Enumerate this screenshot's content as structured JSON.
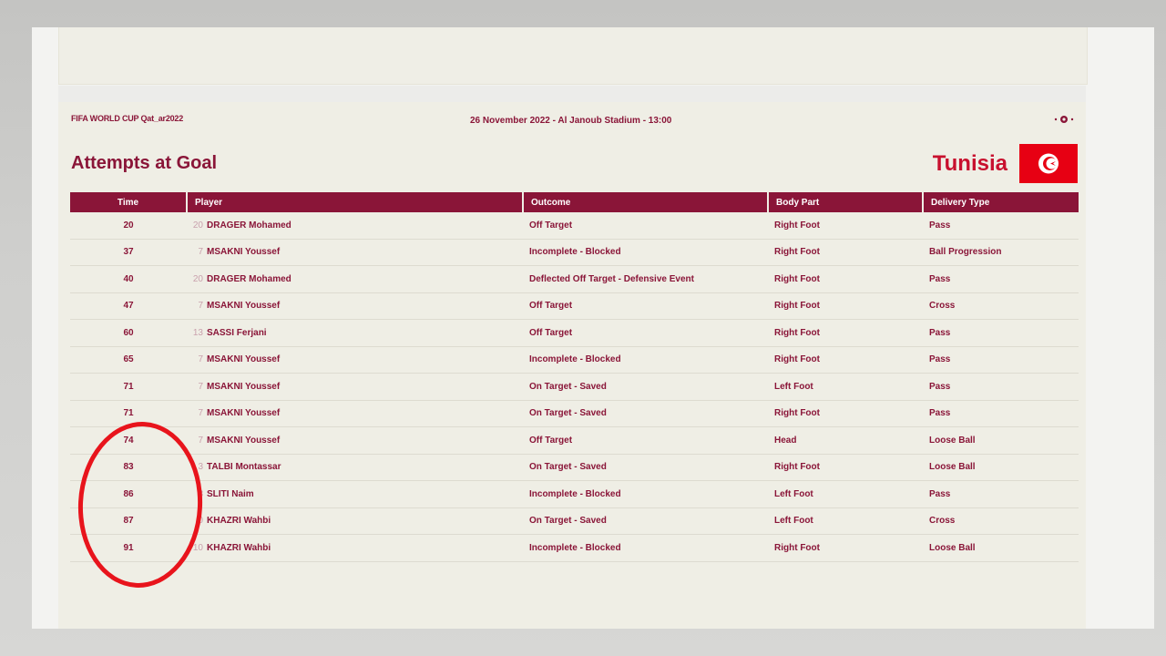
{
  "header": {
    "brand": "FIFA WORLD CUP Qat_ar2022",
    "match_info": "26 November 2022 - Al Janoub Stadium - 13:00"
  },
  "title": "Attempts at Goal",
  "team": {
    "name": "Tunisia",
    "flag_color": "#e70013"
  },
  "columns": [
    "Time",
    "Player",
    "Outcome",
    "Body Part",
    "Delivery Type"
  ],
  "rows": [
    {
      "time": "20",
      "num": "20",
      "player": "DRAGER Mohamed",
      "outcome": "Off Target",
      "body": "Right Foot",
      "delivery": "Pass"
    },
    {
      "time": "37",
      "num": "7",
      "player": "MSAKNI Youssef",
      "outcome": "Incomplete - Blocked",
      "body": "Right Foot",
      "delivery": "Ball Progression"
    },
    {
      "time": "40",
      "num": "20",
      "player": "DRAGER Mohamed",
      "outcome": "Deflected Off Target - Defensive Event",
      "body": "Right Foot",
      "delivery": "Pass"
    },
    {
      "time": "47",
      "num": "7",
      "player": "MSAKNI Youssef",
      "outcome": "Off Target",
      "body": "Right Foot",
      "delivery": "Cross"
    },
    {
      "time": "60",
      "num": "13",
      "player": "SASSI Ferjani",
      "outcome": "Off Target",
      "body": "Right Foot",
      "delivery": "Pass"
    },
    {
      "time": "65",
      "num": "7",
      "player": "MSAKNI Youssef",
      "outcome": "Incomplete - Blocked",
      "body": "Right Foot",
      "delivery": "Pass"
    },
    {
      "time": "71",
      "num": "7",
      "player": "MSAKNI Youssef",
      "outcome": "On Target - Saved",
      "body": "Left Foot",
      "delivery": "Pass"
    },
    {
      "time": "71",
      "num": "7",
      "player": "MSAKNI Youssef",
      "outcome": "On Target - Saved",
      "body": "Right Foot",
      "delivery": "Pass"
    },
    {
      "time": "74",
      "num": "7",
      "player": "MSAKNI Youssef",
      "outcome": "Off Target",
      "body": "Head",
      "delivery": "Loose Ball"
    },
    {
      "time": "83",
      "num": "3",
      "player": "TALBI Montassar",
      "outcome": "On Target - Saved",
      "body": "Right Foot",
      "delivery": "Loose Ball"
    },
    {
      "time": "86",
      "num": "3",
      "player": "SLITI Naim",
      "outcome": "Incomplete - Blocked",
      "body": "Left Foot",
      "delivery": "Pass"
    },
    {
      "time": "87",
      "num": "0",
      "player": "KHAZRI Wahbi",
      "outcome": "On Target - Saved",
      "body": "Left Foot",
      "delivery": "Cross"
    },
    {
      "time": "91",
      "num": "10",
      "player": "KHAZRI Wahbi",
      "outcome": "Incomplete - Blocked",
      "body": "Right Foot",
      "delivery": "Loose Ball"
    }
  ],
  "annotation_color": "#e8141c"
}
